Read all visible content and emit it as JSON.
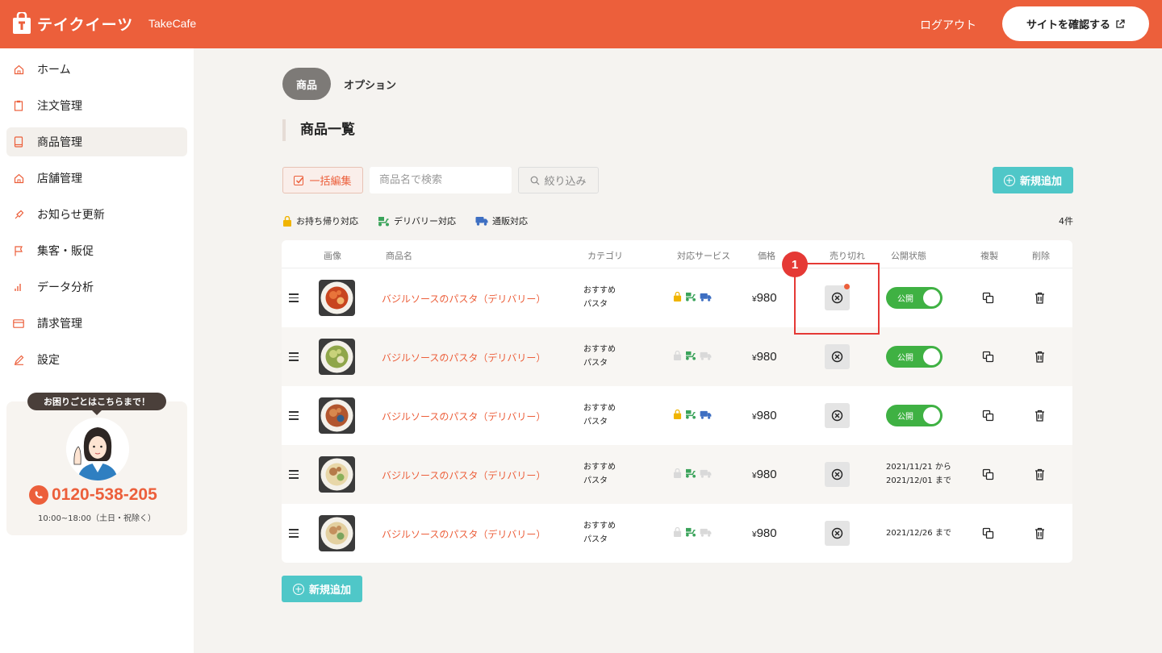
{
  "header": {
    "logo_text": "テイクイーツ",
    "store_name": "TakeCafe",
    "logout_label": "ログアウト",
    "site_button_label": "サイトを確認する"
  },
  "sidebar": {
    "items": [
      {
        "label": "ホーム",
        "icon": "home-icon"
      },
      {
        "label": "注文管理",
        "icon": "clipboard-icon"
      },
      {
        "label": "商品管理",
        "icon": "book-icon",
        "active": true
      },
      {
        "label": "店舗管理",
        "icon": "store-icon"
      },
      {
        "label": "お知らせ更新",
        "icon": "megaphone-icon"
      },
      {
        "label": "集客・販促",
        "icon": "flag-icon"
      },
      {
        "label": "データ分析",
        "icon": "bar-chart-icon"
      },
      {
        "label": "請求管理",
        "icon": "credit-card-icon"
      },
      {
        "label": "設定",
        "icon": "pencil-icon"
      }
    ],
    "support": {
      "bubble": "お困りごとはこちらまで！",
      "phone": "0120-538-205",
      "hours": "10:00~18:00（土日・祝除く）"
    }
  },
  "tabs": {
    "products": "商品",
    "options": "オプション"
  },
  "section_title": "商品一覧",
  "toolbar": {
    "bulk_edit": "一括編集",
    "search_placeholder": "商品名で検索",
    "filter": "絞り込み",
    "new_add": "新規追加"
  },
  "legend": {
    "takeout": "お持ち帰り対応",
    "delivery": "デリバリー対応",
    "mailorder": "通販対応"
  },
  "count": "4件",
  "table": {
    "headers": {
      "image": "画像",
      "name": "商品名",
      "category": "カテゴリ",
      "service": "対応サービス",
      "price": "価格",
      "soldout": "売り切れ",
      "status": "公開状態",
      "copy": "複製",
      "delete": "削除"
    },
    "rows": [
      {
        "name": "バジルソースのパスタ（デリバリー）",
        "cat1": "おすすめ",
        "cat2": "パスタ",
        "yen": "¥",
        "price": "980",
        "takeout": true,
        "delivery": true,
        "mail": true,
        "status_toggle": "公開",
        "status_line1": "",
        "status_line2": ""
      },
      {
        "name": "バジルソースのパスタ（デリバリー）",
        "cat1": "おすすめ",
        "cat2": "パスタ",
        "yen": "¥",
        "price": "980",
        "takeout": false,
        "delivery": true,
        "mail": false,
        "status_toggle": "公開",
        "status_line1": "",
        "status_line2": ""
      },
      {
        "name": "バジルソースのパスタ（デリバリー）",
        "cat1": "おすすめ",
        "cat2": "パスタ",
        "yen": "¥",
        "price": "980",
        "takeout": true,
        "delivery": true,
        "mail": true,
        "status_toggle": "公開",
        "status_line1": "",
        "status_line2": ""
      },
      {
        "name": "バジルソースのパスタ（デリバリー）",
        "cat1": "おすすめ",
        "cat2": "パスタ",
        "yen": "¥",
        "price": "980",
        "takeout": false,
        "delivery": true,
        "mail": false,
        "status_toggle": "",
        "status_line1": "2021/11/21 から",
        "status_line2": "2021/12/01 まで"
      },
      {
        "name": "バジルソースのパスタ（デリバリー）",
        "cat1": "おすすめ",
        "cat2": "パスタ",
        "yen": "¥",
        "price": "980",
        "takeout": false,
        "delivery": true,
        "mail": false,
        "status_toggle": "",
        "status_line1": "2021/12/26 まで",
        "status_line2": ""
      }
    ]
  },
  "bottom_new_add": "新規追加",
  "annotation_badge": "1",
  "colors": {
    "brand": "#ec5f3b",
    "accent_teal": "#4fc7c8",
    "toggle_green": "#3fb143",
    "highlight_red": "#e53935"
  }
}
